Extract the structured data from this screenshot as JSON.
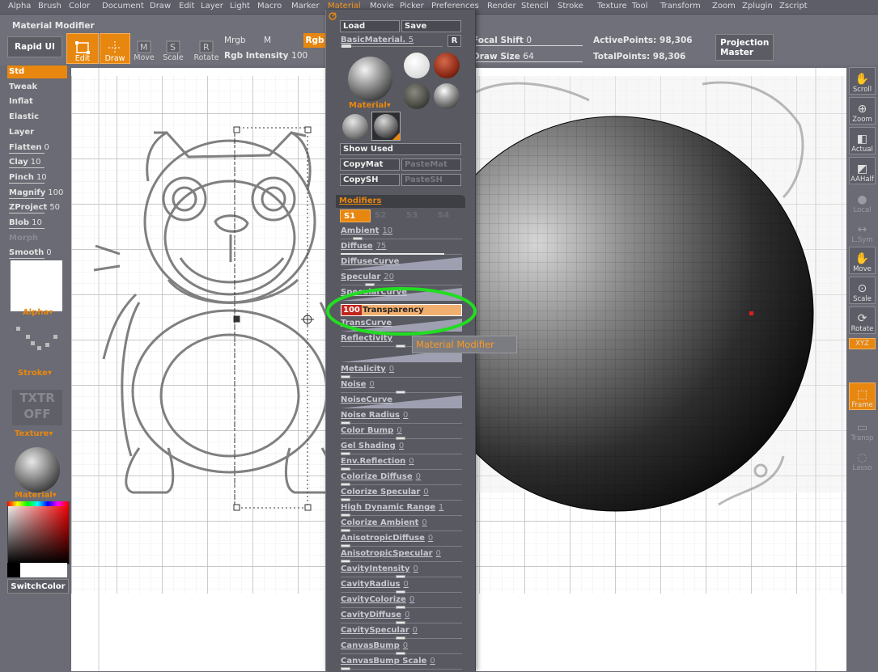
{
  "menu": [
    "Alpha",
    "Brush",
    "Color",
    "Document",
    "Draw",
    "Edit",
    "Layer",
    "Light",
    "Macro",
    "Marker",
    "Material",
    "Movie",
    "Picker",
    "Preferences",
    "Render",
    "Stencil",
    "Stroke",
    "Texture",
    "Tool",
    "Transform",
    "Zoom",
    "Zplugin",
    "Zscript"
  ],
  "menu_active": "Material",
  "window_title": "Material Modifier",
  "toolbar": {
    "rapid_ui": "Rapid UI",
    "edit": "Edit",
    "draw": "Draw",
    "move": "Move",
    "scale": "Scale",
    "rotate": "Rotate",
    "mrgb": "Mrgb",
    "m": "M",
    "rgb": "Rgb",
    "rgb_intensity_label": "Rgb Intensity",
    "rgb_intensity_value": "100",
    "focal_shift_label": "Focal Shift",
    "focal_shift_value": "0",
    "draw_size_label": "Draw Size",
    "draw_size_value": "64",
    "active_points_label": "ActivePoints:",
    "active_points_value": "98,306",
    "total_points_label": "TotalPoints:",
    "total_points_value": "98,306",
    "projection_master": "Projection Master"
  },
  "brushes": [
    {
      "label": "Std",
      "value": ""
    },
    {
      "label": "Tweak",
      "value": ""
    },
    {
      "label": "Inflat",
      "value": ""
    },
    {
      "label": "Elastic",
      "value": ""
    },
    {
      "label": "Layer",
      "value": ""
    },
    {
      "label": "Flatten",
      "value": "0"
    },
    {
      "label": "Clay",
      "value": "10"
    },
    {
      "label": "Pinch",
      "value": "10"
    },
    {
      "label": "Magnify",
      "value": "100"
    },
    {
      "label": "ZProject",
      "value": "50"
    },
    {
      "label": "Blob",
      "value": "10"
    },
    {
      "label": "Morph",
      "value": ""
    },
    {
      "label": "Smooth",
      "value": "0"
    }
  ],
  "left": {
    "alpha": "Alpha",
    "stroke": "Stroke",
    "texture": "Texture",
    "txtr": "TXTR",
    "off": "OFF",
    "material": "Material",
    "switch_color": "SwitchColor"
  },
  "palette": {
    "load": "Load",
    "save": "Save",
    "basic_material": "BasicMaterial.",
    "basic_material_value": "5",
    "r": "R",
    "material_label": "Material",
    "show_used": "Show Used",
    "copy_mat": "CopyMat",
    "paste_mat": "PasteMat",
    "copy_sh": "CopySH",
    "paste_sh": "PasteSH",
    "modifiers": "Modifiers",
    "tabs": [
      "S1",
      "S2",
      "S3",
      "S4"
    ],
    "transparency_value": "100",
    "transparency_label": "Transparency",
    "tooltip": "Material Modifier"
  },
  "modifiers": [
    {
      "label": "Ambient",
      "value": "10",
      "type": "slider",
      "pos": 0.1
    },
    {
      "label": "Diffuse",
      "value": "75",
      "type": "slider",
      "pos": 0.75
    },
    {
      "label": "DiffuseCurve",
      "value": "",
      "type": "curve"
    },
    {
      "label": "Specular",
      "value": "20",
      "type": "slider",
      "pos": 0.2
    },
    {
      "label": "SpecularCurve",
      "value": "",
      "type": "curve"
    },
    {
      "label": "Transparency",
      "value": "100",
      "type": "highlight"
    },
    {
      "label": "TransCurve",
      "value": "",
      "type": "curve"
    },
    {
      "label": "Reflectivity",
      "value": "",
      "type": "slider",
      "pos": 0.45
    },
    {
      "label": "",
      "value": "",
      "type": "curve"
    },
    {
      "label": "Metalicity",
      "value": "0",
      "type": "slider",
      "pos": 0
    },
    {
      "label": "Noise",
      "value": "0",
      "type": "slider",
      "pos": 0.45
    },
    {
      "label": "NoiseCurve",
      "value": "",
      "type": "curve"
    },
    {
      "label": "Noise Radius",
      "value": "0",
      "type": "slider",
      "pos": 0
    },
    {
      "label": "Color Bump",
      "value": "0",
      "type": "slider",
      "pos": 0.45
    },
    {
      "label": "Gel Shading",
      "value": "0",
      "type": "slider",
      "pos": 0
    },
    {
      "label": "Env.Reflection",
      "value": "0",
      "type": "slider",
      "pos": 0
    },
    {
      "label": "Colorize Diffuse",
      "value": "0",
      "type": "slider",
      "pos": 0
    },
    {
      "label": "Colorize Specular",
      "value": "0",
      "type": "slider",
      "pos": 0
    },
    {
      "label": "High Dynamic Range",
      "value": "1",
      "type": "slider",
      "pos": 0
    },
    {
      "label": "Colorize Ambient",
      "value": "0",
      "type": "slider",
      "pos": 0
    },
    {
      "label": "AnisotropicDiffuse",
      "value": "0",
      "type": "slider",
      "pos": 0
    },
    {
      "label": "AnisotropicSpecular",
      "value": "0",
      "type": "slider",
      "pos": 0
    },
    {
      "label": "CavityIntensity",
      "value": "0",
      "type": "slider",
      "pos": 0.45
    },
    {
      "label": "CavityRadius",
      "value": "0",
      "type": "slider",
      "pos": 0.45
    },
    {
      "label": "CavityColorize",
      "value": "0",
      "type": "slider",
      "pos": 0.45
    },
    {
      "label": "CavityDiffuse",
      "value": "0",
      "type": "slider",
      "pos": 0.45
    },
    {
      "label": "CavitySpecular",
      "value": "0",
      "type": "slider",
      "pos": 0.45
    },
    {
      "label": "CanvasBump",
      "value": "0",
      "type": "slider",
      "pos": 0.45
    },
    {
      "label": "CanvasBump Scale",
      "value": "0",
      "type": "slider",
      "pos": 0
    }
  ],
  "right": [
    "Scroll",
    "Zoom",
    "Actual",
    "AAHalf",
    "Local",
    "L.Sym",
    "Move",
    "Scale",
    "Rotate",
    "XYZ",
    "",
    "Frame",
    "Transp",
    "Lasso"
  ],
  "colors": {
    "accent": "#e8870f",
    "highlight_circle": "#22dd22",
    "panel": "#585961"
  }
}
